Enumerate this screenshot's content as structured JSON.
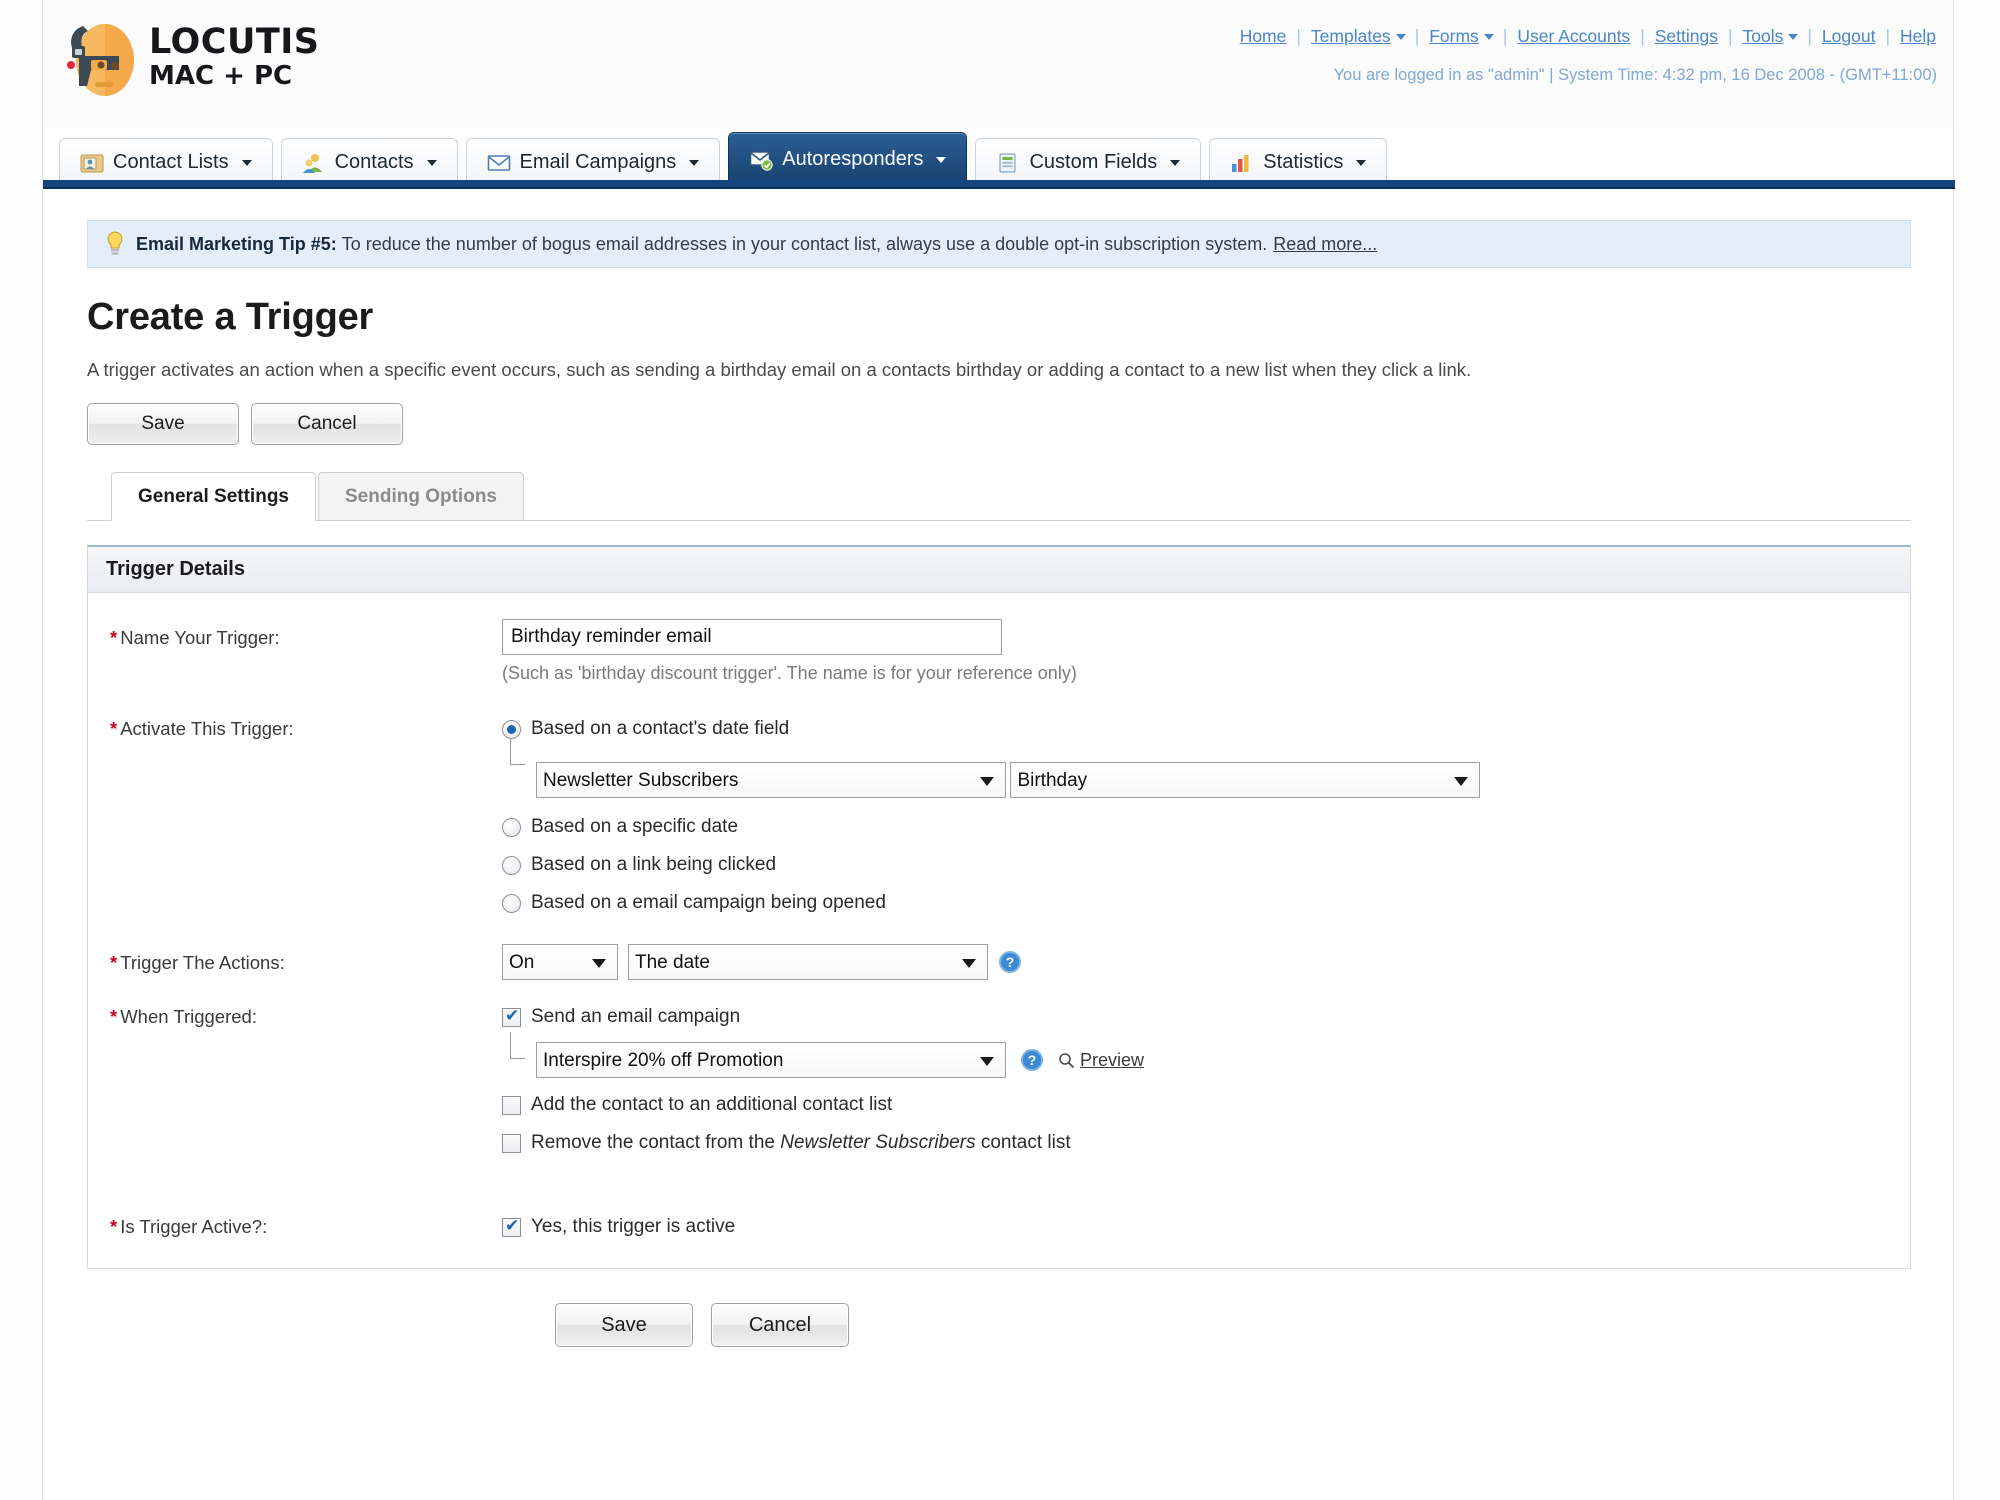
{
  "brand": {
    "name": "LOCUTIS",
    "tagline": "MAC + PC",
    "logo_icon": "robot-head-icon"
  },
  "topnav": {
    "items": [
      {
        "label": "Home",
        "has_caret": false
      },
      {
        "label": "Templates",
        "has_caret": true
      },
      {
        "label": "Forms",
        "has_caret": true
      },
      {
        "label": "User Accounts",
        "has_caret": false
      },
      {
        "label": "Settings",
        "has_caret": false
      },
      {
        "label": "Tools",
        "has_caret": true
      },
      {
        "label": "Logout",
        "has_caret": false
      },
      {
        "label": "Help",
        "has_caret": false
      }
    ],
    "separator": "|",
    "status_line": "You are logged in as \"admin\" | System Time: 4:32 pm, 16 Dec 2008 - (GMT+11:00)"
  },
  "tabs": [
    {
      "label": "Contact Lists",
      "icon": "contact-list-icon",
      "active": false
    },
    {
      "label": "Contacts",
      "icon": "contacts-icon",
      "active": false
    },
    {
      "label": "Email Campaigns",
      "icon": "envelope-icon",
      "active": false
    },
    {
      "label": "Autoresponders",
      "icon": "autoresponder-icon",
      "active": true
    },
    {
      "label": "Custom Fields",
      "icon": "custom-fields-icon",
      "active": false
    },
    {
      "label": "Statistics",
      "icon": "statistics-icon",
      "active": false
    }
  ],
  "tip": {
    "icon": "lightbulb-icon",
    "label": "Email Marketing Tip #5:",
    "body": "To reduce the number of bogus email addresses in your contact list, always use a double opt-in subscription system.",
    "read_more": "Read more..."
  },
  "page": {
    "title": "Create a Trigger",
    "description": "A trigger activates an action when a specific event occurs, such as sending a birthday email on a contacts birthday or adding a contact to a new list when they click a link."
  },
  "actions": {
    "save": "Save",
    "cancel": "Cancel"
  },
  "subtabs": [
    {
      "label": "General Settings",
      "active": true
    },
    {
      "label": "Sending Options",
      "active": false
    }
  ],
  "panel": {
    "heading": "Trigger Details"
  },
  "form": {
    "name_field": {
      "label": "Name Your Trigger:",
      "required": true,
      "value": "Birthday reminder email",
      "hint": "(Such as 'birthday discount trigger'. The name is for your reference only)"
    },
    "activate": {
      "label": "Activate This Trigger:",
      "required": true,
      "options": [
        {
          "label": "Based on a contact's date field",
          "selected": true
        },
        {
          "label": "Based on a specific date",
          "selected": false
        },
        {
          "label": "Based on a link being clicked",
          "selected": false
        },
        {
          "label": "Based on a email campaign being opened",
          "selected": false
        }
      ],
      "list_select": {
        "value": "Newsletter Subscribers",
        "options": [
          "Newsletter Subscribers"
        ]
      },
      "field_select": {
        "value": "Birthday",
        "options": [
          "Birthday"
        ]
      }
    },
    "trigger_actions": {
      "label": "Trigger The Actions:",
      "required": true,
      "when_select": {
        "value": "On",
        "options": [
          "On"
        ]
      },
      "what_select": {
        "value": "The date",
        "options": [
          "The date"
        ]
      },
      "help_icon": "help-question-icon"
    },
    "when_triggered": {
      "label": "When Triggered:",
      "required": true,
      "send_campaign": {
        "label": "Send an email campaign",
        "checked": true,
        "campaign_select": {
          "value": "Interspire 20% off Promotion",
          "options": [
            "Interspire 20% off Promotion"
          ]
        },
        "help_icon": "help-question-icon",
        "preview_label": "Preview",
        "preview_icon": "magnifier-icon"
      },
      "add_to_list": {
        "label": "Add the contact to an additional contact list",
        "checked": false
      },
      "remove_from_list": {
        "label_before": "Remove the contact from the",
        "label_emphasis": "Newsletter Subscribers",
        "label_after": "contact list",
        "checked": false
      }
    },
    "is_active": {
      "label": "Is Trigger Active?:",
      "required": true,
      "checkbox_label": "Yes, this trigger is active",
      "checked": true
    }
  },
  "colors": {
    "accent_blue": "#14457e",
    "link_blue": "#4a86c8",
    "required_red": "#d0021b",
    "tip_bg": "#e4edf8",
    "logo_orange": "#f4aa4a"
  }
}
